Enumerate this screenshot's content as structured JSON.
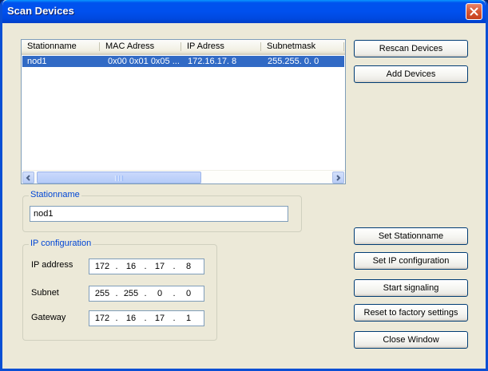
{
  "window": {
    "title": "Scan Devices"
  },
  "devices": {
    "columns": [
      "Stationname",
      "MAC Adress",
      "IP Adress",
      "Subnetmask"
    ],
    "rows": [
      {
        "stationname": "nod1",
        "mac": "0x00 0x01 0x05 ...",
        "ip": "172.16.17. 8",
        "subnet": "255.255. 0. 0",
        "selected": true
      }
    ]
  },
  "buttons": {
    "rescan": "Rescan Devices",
    "add": "Add Devices",
    "set_stationname": "Set Stationname",
    "set_ip": "Set IP configuration",
    "start_signaling": "Start signaling",
    "reset_factory": "Reset to factory settings",
    "close_window": "Close Window"
  },
  "stationname_group": {
    "label": "Stationname",
    "value": "nod1"
  },
  "ip_group": {
    "label": "IP configuration",
    "ip_address": {
      "label": "IP address",
      "octets": [
        "172",
        "16",
        "17",
        "8"
      ]
    },
    "subnet": {
      "label": "Subnet",
      "octets": [
        "255",
        "255",
        "0",
        "0"
      ]
    },
    "gateway": {
      "label": "Gateway",
      "octets": [
        "172",
        "16",
        "17",
        "1"
      ]
    }
  },
  "colors": {
    "titlebar": "#0053ee",
    "selection": "#316ac5",
    "groupbox_label": "#0046d5",
    "face": "#ece9d8"
  }
}
